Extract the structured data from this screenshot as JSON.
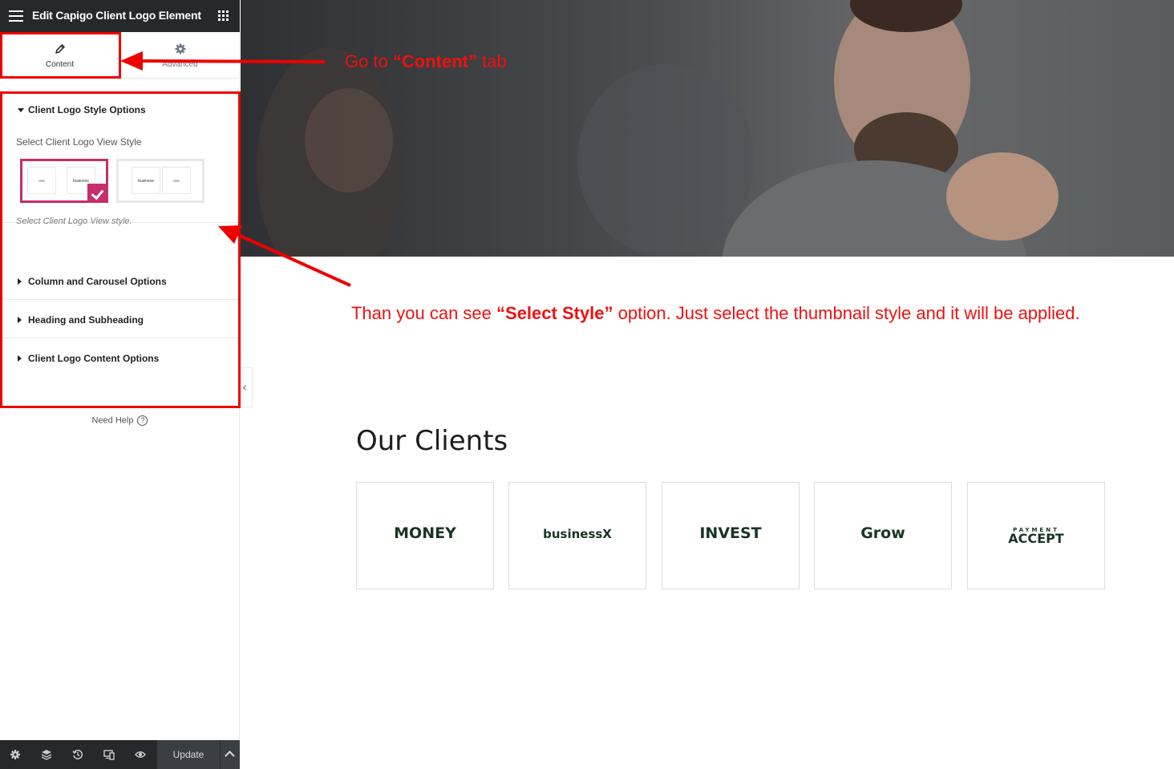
{
  "panel": {
    "title": "Edit Capigo Client Logo Element",
    "tabs": [
      {
        "label": "Content",
        "icon": "pencil-icon"
      },
      {
        "label": "Advanced",
        "icon": "gear-icon"
      }
    ],
    "style_section": {
      "title": "Client Logo Style Options",
      "field_label": "Select Client Logo View Style",
      "help_text": "Select Client Logo View style.",
      "thumbnails": [
        {
          "mini_left": "∞∞",
          "mini_right": "business",
          "selected": true
        },
        {
          "mini_left": "business",
          "mini_right": "∞∞",
          "selected": false
        }
      ]
    },
    "sections": [
      {
        "title": "Column and Carousel Options"
      },
      {
        "title": "Heading and Subheading"
      },
      {
        "title": "Client Logo Content Options"
      }
    ],
    "need_help": "Need Help",
    "footer": {
      "icons": [
        "settings-icon",
        "layers-icon",
        "history-icon",
        "responsive-icon",
        "preview-eye-icon"
      ],
      "update_label": "Update"
    }
  },
  "clients": {
    "title": "Our Clients",
    "logos": [
      {
        "text": "MONEY"
      },
      {
        "text": "businessX"
      },
      {
        "text": "INVEST"
      },
      {
        "text": "Grow"
      },
      {
        "text": "ACCEPT",
        "small": "PAYMENT"
      }
    ]
  },
  "annotations": {
    "content_tab": {
      "prefix": "Go  to ",
      "bold": "“Content”",
      "suffix": " tab"
    },
    "select_style": {
      "prefix": "Than you can see ",
      "bold": "“Select Style”",
      "suffix": " option. Just select the thumbnail style and it will be applied."
    },
    "color": "#ee1111"
  },
  "colors": {
    "accent": "#c42e6a",
    "panel_dark": "#26292c",
    "logo_green": "#173523"
  }
}
